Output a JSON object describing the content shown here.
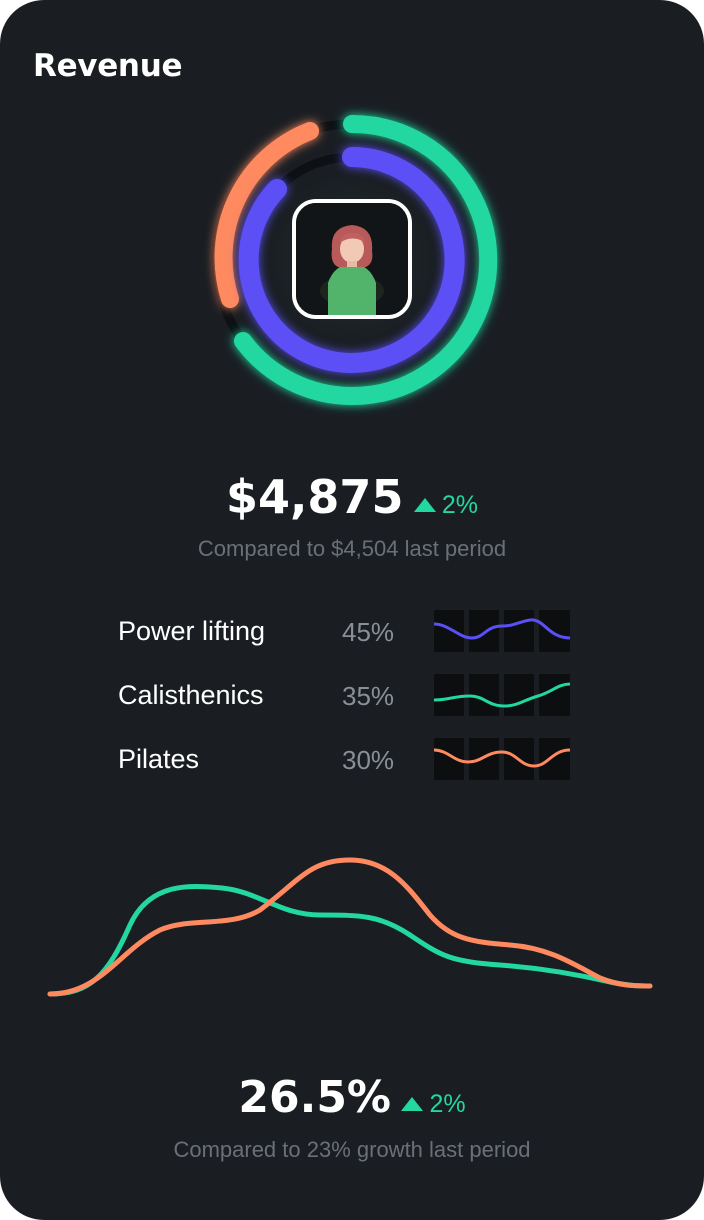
{
  "title": "Revenue",
  "colors": {
    "green": "#22d8a0",
    "purple": "#5b50f5",
    "orange": "#ff8a60"
  },
  "revenue": {
    "value": "$4,875",
    "delta": "2%",
    "compare": "Compared to $4,504 last period"
  },
  "categories": [
    {
      "name": "Power lifting",
      "percent": "45%",
      "color": "purple"
    },
    {
      "name": "Calisthenics",
      "percent": "35%",
      "color": "green"
    },
    {
      "name": "Pilates",
      "percent": "30%",
      "color": "orange"
    }
  ],
  "growth": {
    "value": "26.5%",
    "delta": "2%",
    "compare": "Compared to 23% growth last period"
  }
}
